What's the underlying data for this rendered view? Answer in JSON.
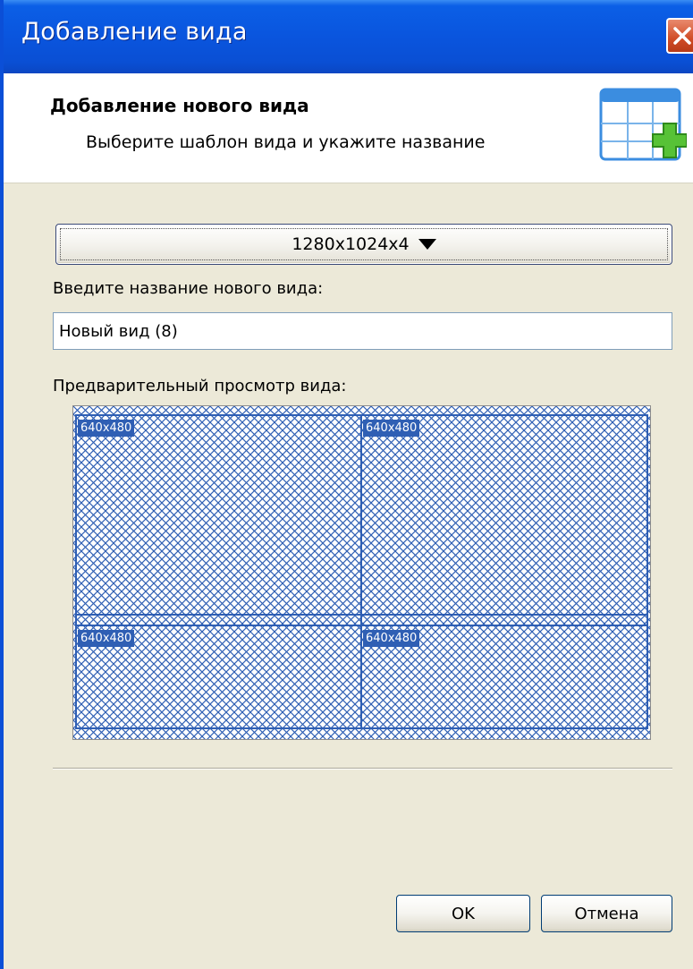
{
  "window": {
    "title": "Добавление вида"
  },
  "header": {
    "title": "Добавление нового вида",
    "subtitle": "Выберите шаблон вида и укажите название"
  },
  "template": {
    "selected": "1280x1024x4"
  },
  "name": {
    "label": "Введите название нового вида:",
    "value": "Новый вид (8)"
  },
  "preview": {
    "label": "Предварительный просмотр вида:",
    "cells": [
      "640x480",
      "640x480",
      "640x480",
      "640x480"
    ]
  },
  "buttons": {
    "ok": "OK",
    "cancel": "Отмена"
  },
  "colors": {
    "titlebar": "#0a55de",
    "grid": "#2f5fb4",
    "dialog_bg": "#ece9d8"
  }
}
